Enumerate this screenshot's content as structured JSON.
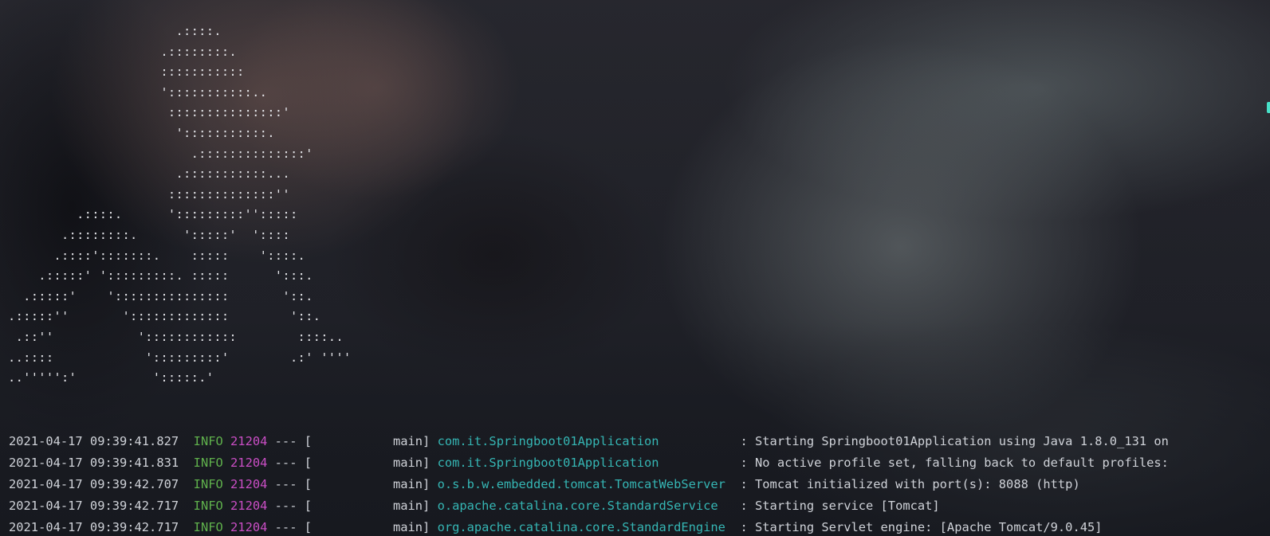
{
  "banner": {
    "lines": [
      "                      .::::.",
      "                    .::::::::.",
      "                    :::::::::::",
      "                    ':::::::::::..",
      "                     :::::::::::::::'",
      "                      ':::::::::::.",
      "                        .::::::::::::::'",
      "                      .:::::::::::...",
      "                     ::::::::::::::''",
      "         .::::.      ':::::::::'':::::",
      "       .::::::::.      ':::::'  '::::",
      "      .::::':::::::.    :::::    '::::.",
      "    .:::::' ':::::::::. :::::      ':::.",
      "  .:::::'    ':::::::::::::::       '::.",
      ".:::::''       ':::::::::::::        '::.",
      " .::''           '::::::::::::        ::::..",
      "..::::            ':::::::::'        .:' ''''",
      "..''''':'          ':::::.'"
    ]
  },
  "log": {
    "rows": [
      {
        "timestamp": "2021-04-17 09:39:41.827",
        "level": "INFO",
        "pid": "21204",
        "separator": "---",
        "thread": "[           main]",
        "logger": "com.it.Springboot01Application",
        "message": ": Starting Springboot01Application using Java 1.8.0_131 on"
      },
      {
        "timestamp": "2021-04-17 09:39:41.831",
        "level": "INFO",
        "pid": "21204",
        "separator": "---",
        "thread": "[           main]",
        "logger": "com.it.Springboot01Application",
        "message": ": No active profile set, falling back to default profiles:"
      },
      {
        "timestamp": "2021-04-17 09:39:42.707",
        "level": "INFO",
        "pid": "21204",
        "separator": "---",
        "thread": "[           main]",
        "logger": "o.s.b.w.embedded.tomcat.TomcatWebServer",
        "message": ": Tomcat initialized with port(s): 8088 (http)"
      },
      {
        "timestamp": "2021-04-17 09:39:42.717",
        "level": "INFO",
        "pid": "21204",
        "separator": "---",
        "thread": "[           main]",
        "logger": "o.apache.catalina.core.StandardService",
        "message": ": Starting service [Tomcat]"
      },
      {
        "timestamp": "2021-04-17 09:39:42.717",
        "level": "INFO",
        "pid": "21204",
        "separator": "---",
        "thread": "[           main]",
        "logger": "org.apache.catalina.core.StandardEngine",
        "message": ": Starting Servlet engine: [Apache Tomcat/9.0.45]"
      }
    ]
  },
  "colors": {
    "level_info": "#5fb04c",
    "pid": "#c94ec4",
    "logger": "#35b6b4",
    "text": "#cfd2d8"
  }
}
